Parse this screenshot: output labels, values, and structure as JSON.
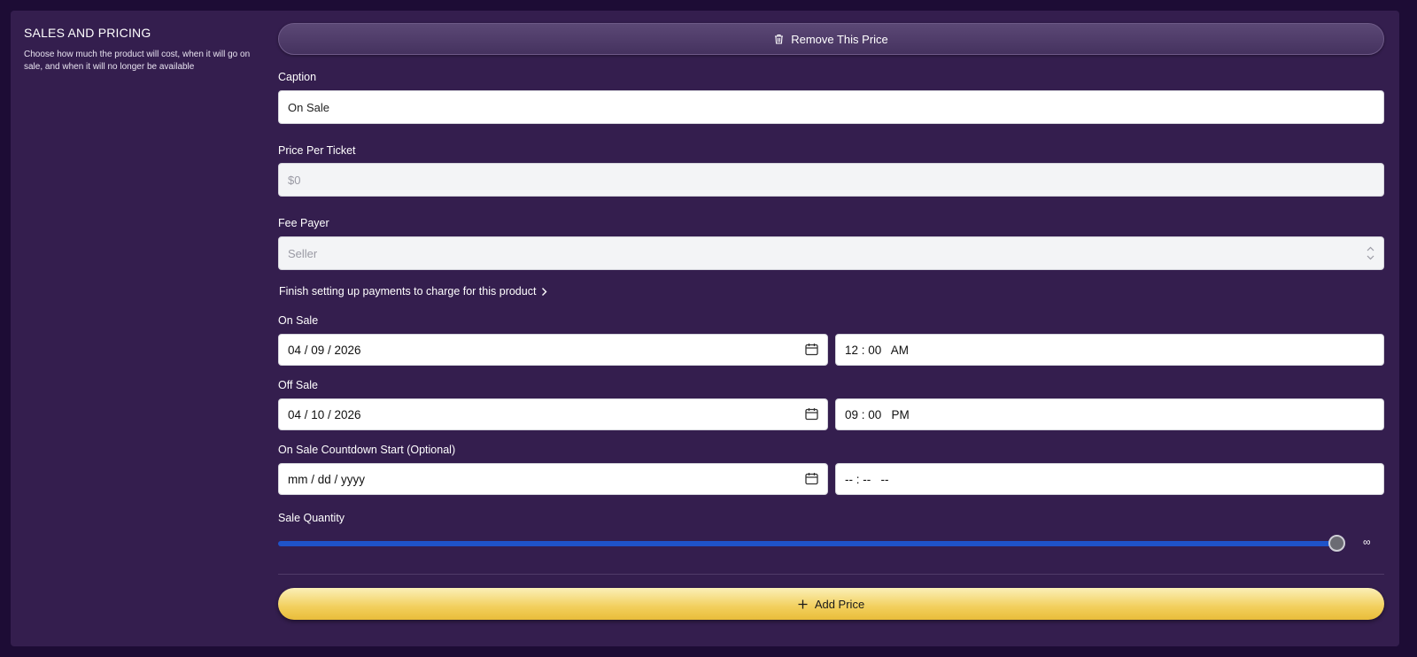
{
  "section": {
    "title": "SALES AND PRICING",
    "description": "Choose how much the product will cost, when it will go on sale, and when it will no longer be available"
  },
  "remove_button": {
    "label": "Remove This Price",
    "icon": "trash-icon"
  },
  "caption": {
    "label": "Caption",
    "value": "On Sale"
  },
  "price": {
    "label": "Price Per Ticket",
    "placeholder": "$0"
  },
  "fee_payer": {
    "label": "Fee Payer",
    "value": "Seller"
  },
  "payments_link": {
    "label": "Finish setting up payments to charge for this product"
  },
  "on_sale": {
    "label": "On Sale",
    "date": "04 / 09 / 2026",
    "time": "12 : 00   AM"
  },
  "off_sale": {
    "label": "Off Sale",
    "date": "04 / 10 / 2026",
    "time": "09 : 00   PM"
  },
  "countdown": {
    "label": "On Sale Countdown Start (Optional)",
    "date": "mm / dd / yyyy",
    "time": "-- : --   --"
  },
  "sale_quantity": {
    "label": "Sale Quantity",
    "value_label": "∞",
    "level": 1.0
  },
  "add_button": {
    "label": "Add Price",
    "icon": "plus-icon"
  },
  "colors": {
    "background": "#1d0c35",
    "panel": "#341e4e",
    "slider": "#1f53c9",
    "add_button": "#f2cf5c"
  }
}
